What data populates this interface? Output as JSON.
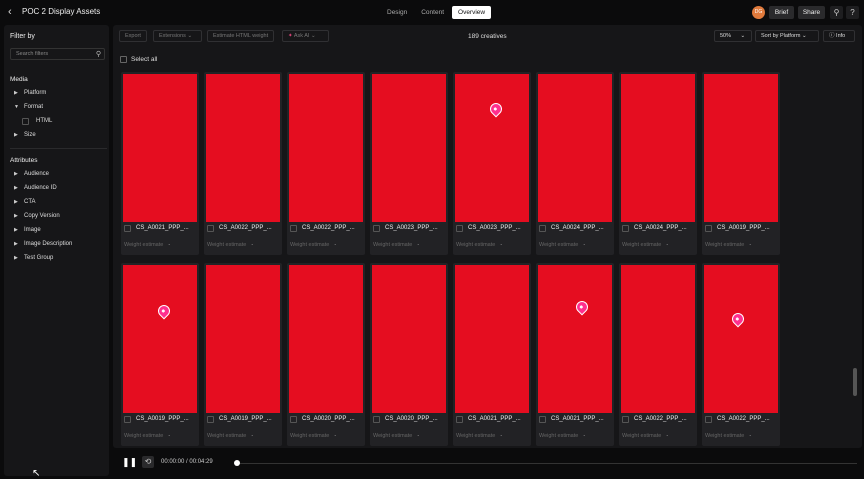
{
  "header": {
    "back_icon": "chevron-left-icon",
    "title": "POC 2 Display Assets",
    "tabs": [
      {
        "label": "Design",
        "active": false
      },
      {
        "label": "Content",
        "active": false
      },
      {
        "label": "Overview",
        "active": true
      }
    ],
    "avatar_initials": "DG",
    "brief_label": "Brief",
    "share_label": "Share"
  },
  "sidebar": {
    "title": "Filter by",
    "search_placeholder": "Search filters",
    "media_heading": "Media",
    "media_items": [
      {
        "label": "Platform",
        "expanded": false
      },
      {
        "label": "Format",
        "expanded": true
      },
      {
        "label": "Size",
        "expanded": false
      }
    ],
    "format_options": [
      "HTML"
    ],
    "attributes_heading": "Attributes",
    "attribute_items": [
      "Audience",
      "Audience ID",
      "CTA",
      "Copy Version",
      "Image",
      "Image Description",
      "Test Group"
    ]
  },
  "toolbar": {
    "export_label": "Export",
    "extensions_label": "Extensions",
    "estimate_label": "Estimate HTML weight",
    "ask_ai_label": "Ask AI",
    "count_label": "189 creatives",
    "zoom_label": "50%",
    "sort_label": "Sort by Platform",
    "info_label": "Info",
    "select_all_label": "Select all"
  },
  "cards": [
    {
      "name": "CS_A0021_PPP_...",
      "weight_label": "Weight estimate",
      "weight_value": "-",
      "pin": false
    },
    {
      "name": "CS_A0022_PPP_...",
      "weight_label": "Weight estimate",
      "weight_value": "-",
      "pin": false
    },
    {
      "name": "CS_A0022_PPP_...",
      "weight_label": "Weight estimate",
      "weight_value": "-",
      "pin": false
    },
    {
      "name": "CS_A0023_PPP_...",
      "weight_label": "Weight estimate",
      "weight_value": "-",
      "pin": false
    },
    {
      "name": "CS_A0023_PPP_...",
      "weight_label": "Weight estimate",
      "weight_value": "-",
      "pin": true
    },
    {
      "name": "CS_A0024_PPP_...",
      "weight_label": "Weight estimate",
      "weight_value": "-",
      "pin": false
    },
    {
      "name": "CS_A0024_PPP_...",
      "weight_label": "Weight estimate",
      "weight_value": "-",
      "pin": false
    },
    {
      "name": "CS_A0019_PPP_...",
      "weight_label": "Weight estimate",
      "weight_value": "-",
      "pin": false
    },
    {
      "name": "CS_A0019_PPP_...",
      "weight_label": "Weight estimate",
      "weight_value": "-",
      "pin": true
    },
    {
      "name": "CS_A0019_PPP_...",
      "weight_label": "Weight estimate",
      "weight_value": "-",
      "pin": false
    },
    {
      "name": "CS_A0020_PPP_...",
      "weight_label": "Weight estimate",
      "weight_value": "-",
      "pin": false
    },
    {
      "name": "CS_A0020_PPP_...",
      "weight_label": "Weight estimate",
      "weight_value": "-",
      "pin": false
    },
    {
      "name": "CS_A0021_PPP_...",
      "weight_label": "Weight estimate",
      "weight_value": "-",
      "pin": false
    },
    {
      "name": "CS_A0021_PPP_...",
      "weight_label": "Weight estimate",
      "weight_value": "-",
      "pin": true
    },
    {
      "name": "CS_A0022_PPP_...",
      "weight_label": "Weight estimate",
      "weight_value": "-",
      "pin": false
    },
    {
      "name": "CS_A0022_PPP_...",
      "weight_label": "Weight estimate",
      "weight_value": "-",
      "pin": true
    }
  ],
  "player": {
    "time_label": "00:00:00 / 00:04:29",
    "progress": 0
  },
  "colors": {
    "creative_red": "#e50d20",
    "pin_pink": "#ff2f8e",
    "avatar": "#e07a3c"
  }
}
